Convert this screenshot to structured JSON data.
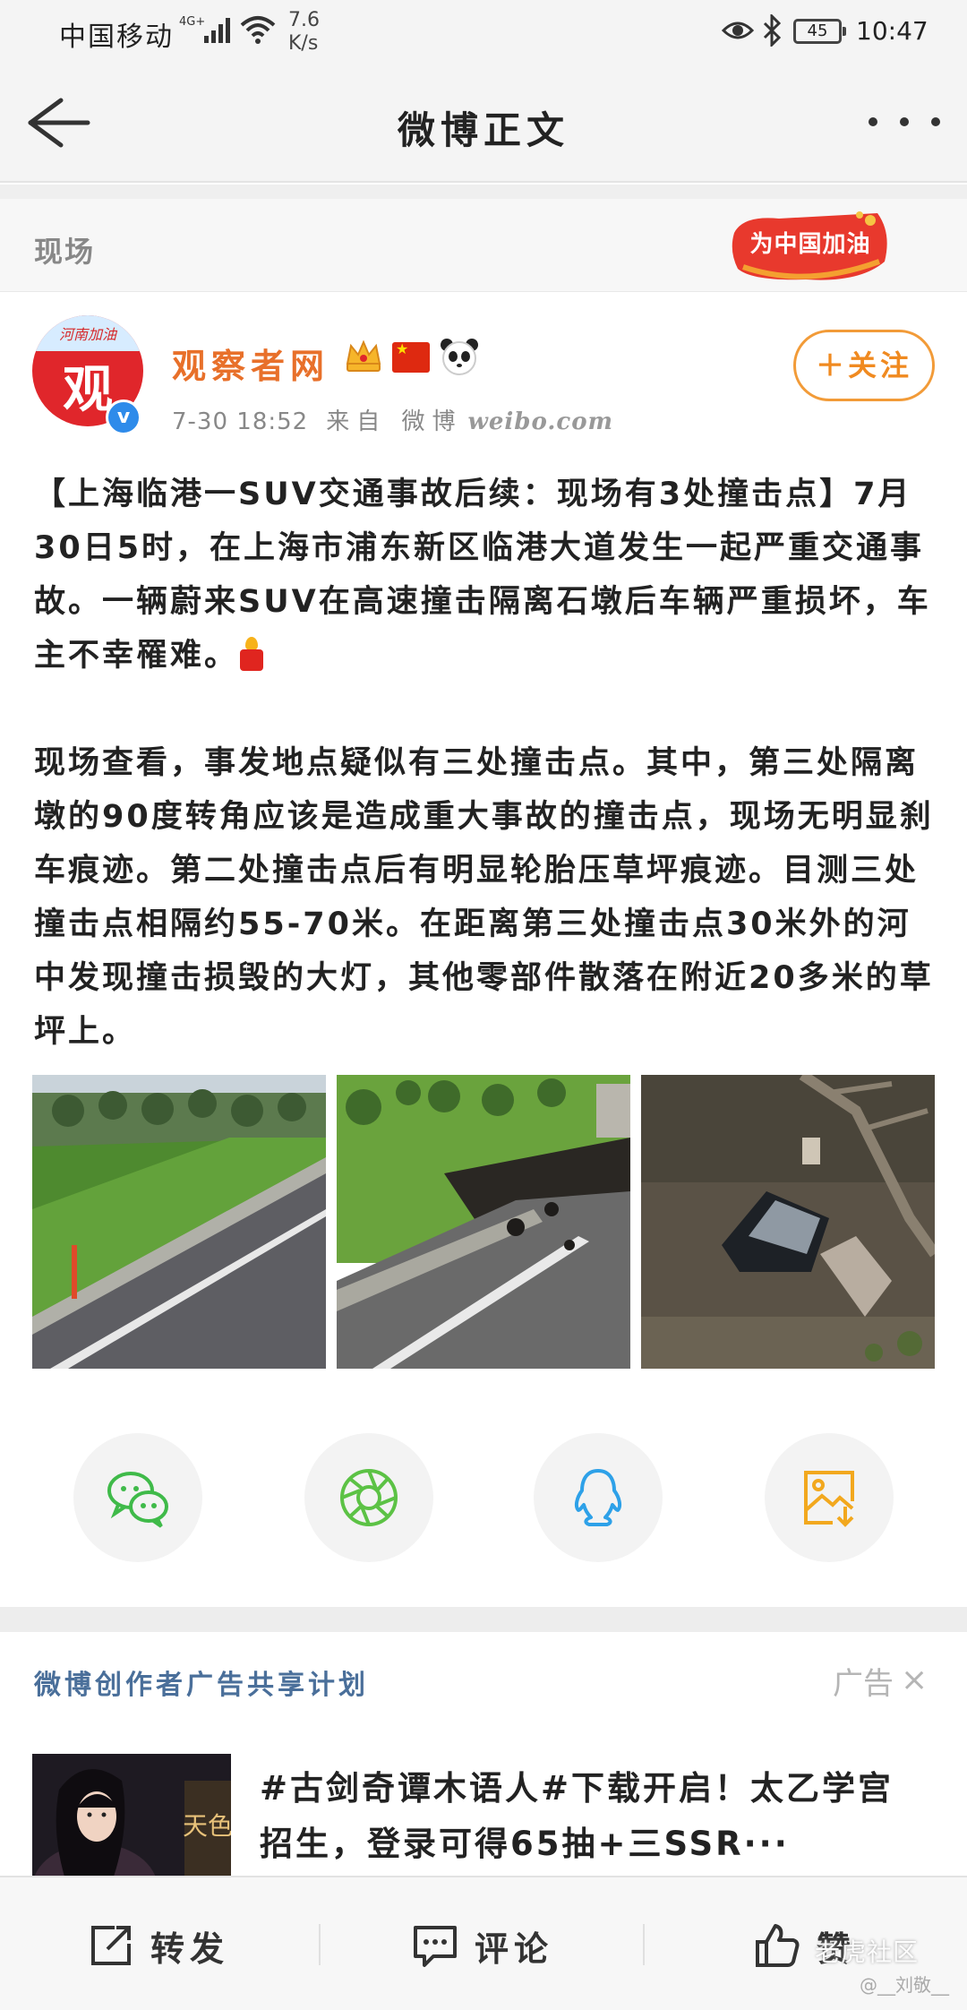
{
  "status_bar": {
    "carrier": "中国移动",
    "network": "4G+",
    "speed_value": "7.6",
    "speed_unit": "K/s",
    "battery": "45",
    "time": "10:47"
  },
  "nav": {
    "title": "微博正文"
  },
  "topic": {
    "label": "现场",
    "badge": "为中国加油"
  },
  "post": {
    "avatar_top": "河南加油",
    "avatar_main": "观",
    "author": "观察者网",
    "time": "7-30 18:52",
    "source": "来自 微博",
    "source_url": "weibo.com",
    "follow_label": "＋关注",
    "paragraph1": "【上海临港一SUV交通事故后续：现场有3处撞击点】7月30日5时，在上海市浦东新区临港大道发生一起严重交通事故。一辆蔚来SUV在高速撞击隔离石墩后车辆严重损坏，车主不幸罹难。",
    "paragraph2": "现场查看，事发地点疑似有三处撞击点。其中，第三处隔离墩的90度转角应该是造成重大事故的撞击点，现场无明显刹车痕迹。第二处撞击点后有明显轮胎压草坪痕迹。目测三处撞击点相隔约55-70米。在距离第三处撞击点30米外的河中发现撞击损毁的大灯，其他零部件散落在附近20多米的草坪上。"
  },
  "share_icons": [
    "wechat-icon",
    "moments-icon",
    "qq-icon",
    "save-image-icon"
  ],
  "ad": {
    "title": "微博创作者广告共享计划",
    "label": "广告",
    "close": "×",
    "thumb_text": "天色",
    "text": "#古剑奇谭木语人#下载开启！太乙学宫招生，登录可得65抽+三SSR···"
  },
  "bottom_bar": {
    "repost": "转发",
    "comment": "评论",
    "like": "赞"
  },
  "watermark": {
    "text": "老虎社区",
    "sub": "@__刘敬__"
  },
  "colors": {
    "accent_orange": "#f08a20",
    "ad_title_blue": "#4a6f9a",
    "verified_blue": "#2e8bea"
  }
}
